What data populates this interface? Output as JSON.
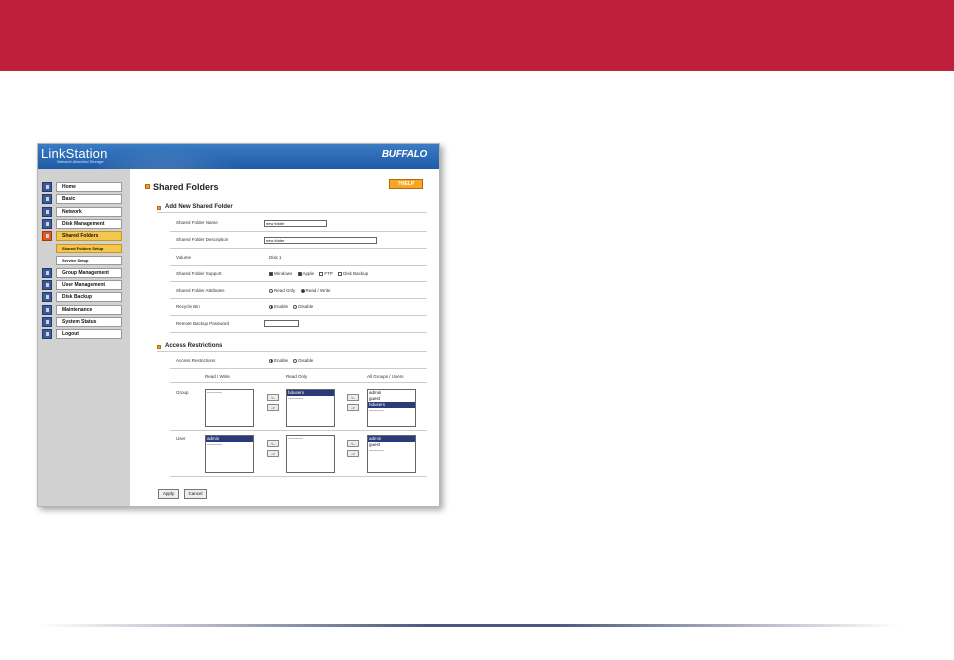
{
  "header": {
    "brand": "LinkStation",
    "tagline": "Network Attached Storage",
    "logo": "BUFFALO"
  },
  "sidebar": {
    "items": [
      {
        "label": "Home",
        "icon": "home-icon"
      },
      {
        "label": "Basic",
        "icon": "basic-icon"
      },
      {
        "label": "Network",
        "icon": "network-icon"
      },
      {
        "label": "Disk Management",
        "icon": "disk-icon"
      },
      {
        "label": "Shared Folders",
        "icon": "folder-icon",
        "active": true
      },
      {
        "label": "Group Management",
        "icon": "group-icon"
      },
      {
        "label": "User Management",
        "icon": "user-icon"
      },
      {
        "label": "Disk Backup",
        "icon": "backup-icon"
      },
      {
        "label": "Maintenance",
        "icon": "maintenance-icon"
      },
      {
        "label": "System Status",
        "icon": "status-icon"
      },
      {
        "label": "Logout",
        "icon": "logout-icon"
      }
    ],
    "subitems": [
      {
        "label": "Shared Folders Setup",
        "active": true
      },
      {
        "label": "Service Setup"
      }
    ]
  },
  "page": {
    "title": "Shared Folders",
    "help_label": "?HELP"
  },
  "add_section": {
    "title": "Add New Shared Folder",
    "folder_name": {
      "label": "Shared Folder Name",
      "value": "new folder"
    },
    "folder_desc": {
      "label": "Shared Folder Description",
      "value": "new folder"
    },
    "volume": {
      "label": "Volume",
      "value": "Disk 1"
    },
    "support": {
      "label": "Shared Folder Support",
      "options": [
        "Windows",
        "Apple",
        "FTP",
        "Disk Backup"
      ]
    },
    "attributes": {
      "label": "Shared Folder Attributes",
      "options": [
        "Read Only",
        "Read / Write"
      ]
    },
    "recycle": {
      "label": "Recycle Bin",
      "options": [
        "Enable",
        "Disable"
      ]
    },
    "backup_pw": {
      "label": "Remote Backup Password",
      "value": ""
    }
  },
  "access_section": {
    "title": "Access Restrictions",
    "label": "Access Restrictions",
    "options": [
      "Enable",
      "Disable"
    ],
    "col_rw": "Read / Write",
    "col_ro": "Read Only",
    "col_all": "All Groups / Users",
    "group_label": "Group",
    "user_label": "User",
    "group_rw": [
      "----------"
    ],
    "group_ro": [
      "hdusers",
      "----------"
    ],
    "group_all": [
      "admin",
      "guest",
      "hdusers",
      "----------"
    ],
    "user_rw": [
      "admin",
      "----------"
    ],
    "user_ro": [
      "----------"
    ],
    "user_all": [
      "admin",
      "guest",
      "----------"
    ],
    "arrow_left": "<-",
    "arrow_right": "->"
  },
  "actions": {
    "apply": "Apply",
    "cancel": "Cancel"
  },
  "colors": {
    "top_band": "#c01f3c",
    "banner": "#1e5aa6",
    "accent": "#f6a623",
    "selection": "#2b3a78"
  }
}
